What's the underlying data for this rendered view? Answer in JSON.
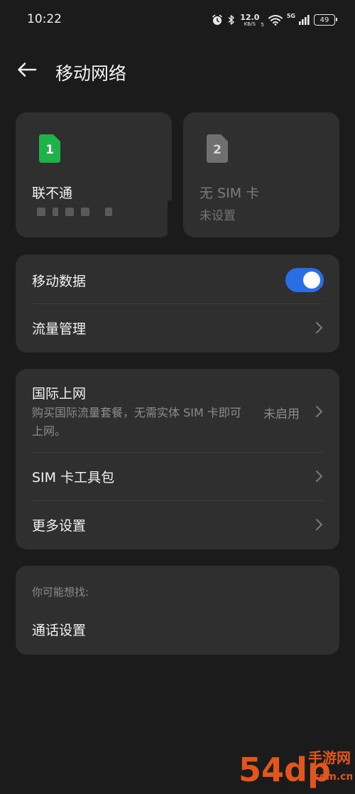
{
  "status_bar": {
    "time": "10:22",
    "net_speed_value": "12.0",
    "net_speed_unit": "KB/S",
    "network_gen": "5G",
    "sim_slot_mark": "5",
    "battery": "49"
  },
  "header": {
    "title": "移动网络"
  },
  "sim_cards": [
    {
      "slot": "1",
      "name": "联不通",
      "status": "",
      "color": "#1fb14a"
    },
    {
      "slot": "2",
      "name": "无 SIM 卡",
      "status": "未设置",
      "color": "#707070"
    }
  ],
  "data_group": {
    "mobile_data_label": "移动数据",
    "mobile_data_enabled": true,
    "traffic_label": "流量管理"
  },
  "settings_group": {
    "intl_label": "国际上网",
    "intl_desc": "购买国际流量套餐，无需实体 SIM 卡即可上网。",
    "intl_value": "未启用",
    "toolkit_label": "SIM 卡工具包",
    "more_label": "更多设置"
  },
  "suggest_group": {
    "title": "你可能想找:",
    "call_settings_label": "通话设置"
  },
  "watermark": {
    "brand": "54dp",
    "site_name": "手游网",
    "domain": ".com.cn"
  },
  "colors": {
    "background": "#1b1b1b",
    "card": "#2f2f2f",
    "accent": "#2a6ee6",
    "sim1": "#1fb14a",
    "watermark": "#e0561c"
  }
}
